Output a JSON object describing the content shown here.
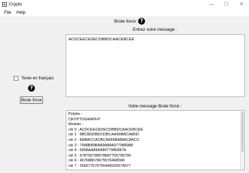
{
  "window": {
    "title": "Crypto",
    "controls": [
      "—",
      "☐",
      "✕"
    ]
  },
  "menu": {
    "items": [
      "File",
      "Help"
    ]
  },
  "header": {
    "label": "Brute force :",
    "help_glyph": "?"
  },
  "left": {
    "checkbox_label": "Texte en français",
    "checkbox_checked": false,
    "help_glyph": "?",
    "button_label": "Brute force"
  },
  "input_panel": {
    "title": "Entrez votre message :",
    "message": "ACDCEECEDECDBBDCAACEBCEE"
  },
  "output_panel": {
    "title": "Votre message Brute forcé :",
    "lines": [
      "Polybe :",
      "CRYPTOGRAPHY",
      "Modulo :",
      "clé 0 : ACDCEECEDECDBBDCAACEBCEE",
      "clé 1 : 9BCBDDBDCDBCAA99BBCA8DD",
      "clé 2 : 8ABACCACBCA899BA88AC8ACC",
      "clé 3 : 7948B89BA89A88A977988988",
      "clé 4 : 6898AA89A98977986887A",
      "clé 5 : 578790798978687755796799",
      "clé 6 : 467688678675576468568",
      "clé 7 : 356577576756446535574577"
    ]
  }
}
